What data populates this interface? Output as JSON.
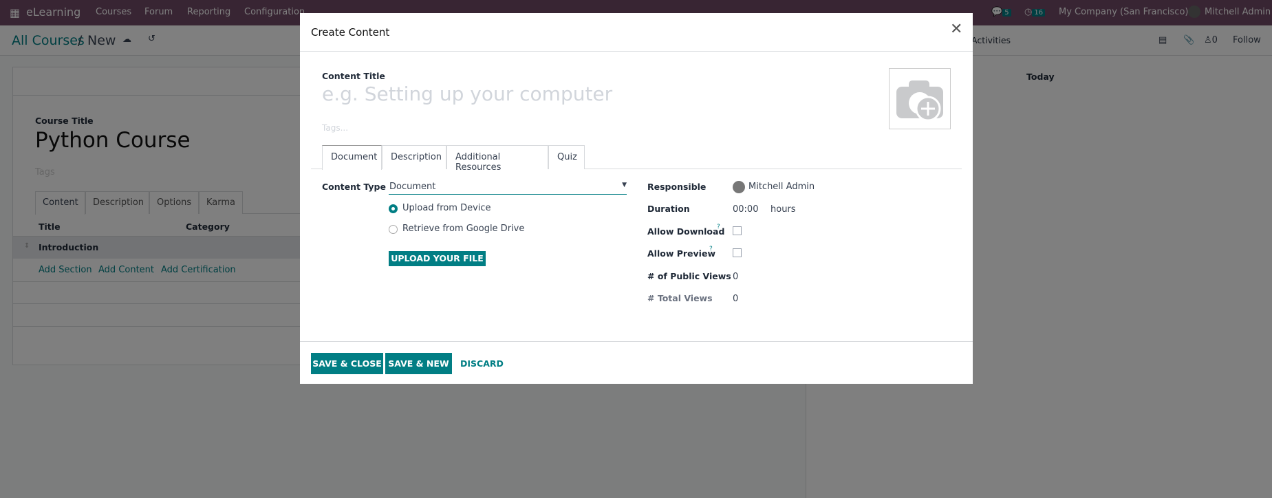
{
  "navbar": {
    "app": "eLearning",
    "menus": [
      "Courses",
      "Forum",
      "Reporting",
      "Configuration"
    ],
    "messages_count": "5",
    "activities_count": "16",
    "company": "My Company (San Francisco)",
    "user": "Mitchell Admin"
  },
  "breadcrumb": {
    "parent": "All Courses",
    "current": "New"
  },
  "chatter": {
    "activities": "Activities",
    "followers_count": "0",
    "follow": "Follow",
    "today": "Today"
  },
  "course": {
    "title_label": "Course Title",
    "title": "Python Course",
    "tags_placeholder": "Tags",
    "tabs": [
      "Content",
      "Description",
      "Options",
      "Karma"
    ],
    "columns": [
      "Title",
      "Category"
    ],
    "section": "Introduction",
    "actions": [
      "Add Section",
      "Add Content",
      "Add Certification"
    ]
  },
  "modal": {
    "title": "Create Content",
    "content_title_label": "Content Title",
    "content_title_placeholder": "e.g. Setting up your computer",
    "tags_placeholder": "Tags...",
    "tabs": [
      "Document",
      "Description",
      "Additional Resources",
      "Quiz"
    ],
    "content_type_label": "Content Type",
    "content_type": "Document",
    "source_options": [
      "Upload from Device",
      "Retrieve from Google Drive"
    ],
    "upload_button": "UPLOAD YOUR FILE",
    "fields": {
      "responsible_label": "Responsible",
      "responsible": "Mitchell Admin",
      "duration_label": "Duration",
      "duration": "00:00",
      "duration_unit": "hours",
      "allow_download_label": "Allow Download",
      "allow_preview_label": "Allow Preview",
      "help_mark": "?",
      "public_views_label": "# of Public Views",
      "public_views": "0",
      "total_views_label": "# Total Views",
      "total_views": "0"
    },
    "buttons": {
      "save_close": "SAVE & CLOSE",
      "save_new": "SAVE & NEW",
      "discard": "DISCARD"
    }
  }
}
